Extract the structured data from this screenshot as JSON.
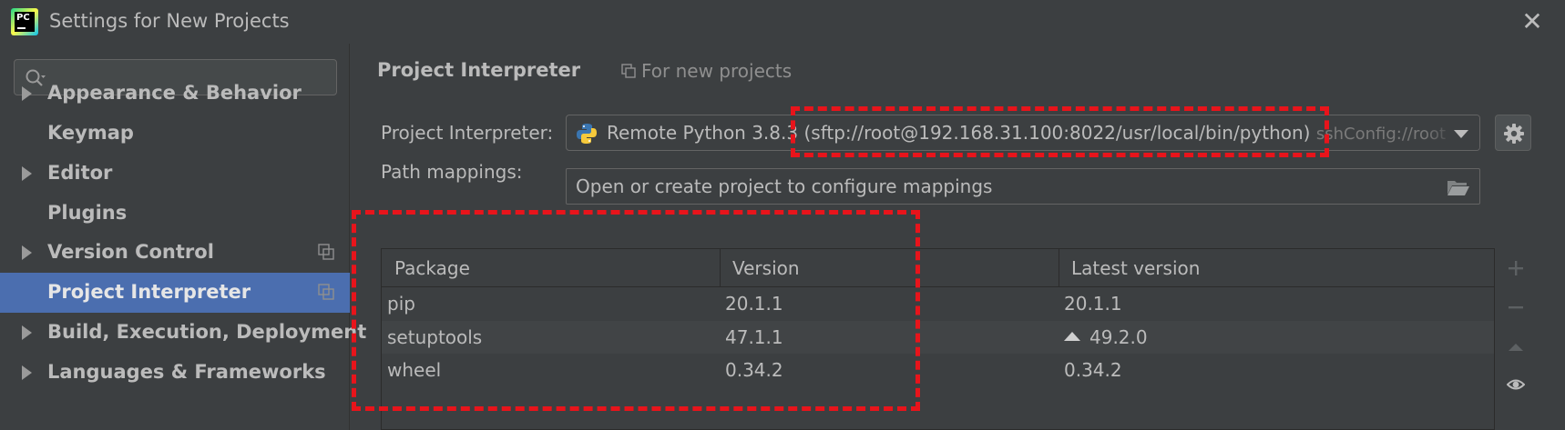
{
  "window": {
    "title": "Settings for New Projects",
    "logo_text": "PC"
  },
  "sidebar": {
    "search": {
      "placeholder": "",
      "value": ""
    },
    "items": [
      {
        "label": "Appearance & Behavior",
        "expandable": true,
        "copy_icon": false,
        "selected": false
      },
      {
        "label": "Keymap",
        "expandable": false,
        "copy_icon": false,
        "selected": false
      },
      {
        "label": "Editor",
        "expandable": true,
        "copy_icon": false,
        "selected": false
      },
      {
        "label": "Plugins",
        "expandable": false,
        "copy_icon": false,
        "selected": false
      },
      {
        "label": "Version Control",
        "expandable": true,
        "copy_icon": true,
        "selected": false
      },
      {
        "label": "Project Interpreter",
        "expandable": false,
        "copy_icon": true,
        "selected": true
      },
      {
        "label": "Build, Execution, Deployment",
        "expandable": true,
        "copy_icon": false,
        "selected": false
      },
      {
        "label": "Languages & Frameworks",
        "expandable": true,
        "copy_icon": false,
        "selected": false
      }
    ]
  },
  "main": {
    "title": "Project Interpreter",
    "scope_hint": "For new projects",
    "interpreter": {
      "label": "Project Interpreter:",
      "prefix": "Remote Python 3.8.3",
      "path": "(sftp://root@192.168.31.100:8022/usr/local/bin/python)",
      "suffix": "sshConfig://root"
    },
    "path_mappings": {
      "label": "Path mappings:",
      "value": "Open or create project to configure mappings"
    },
    "packages": {
      "columns": [
        "Package",
        "Version",
        "Latest version"
      ],
      "rows": [
        {
          "package": "pip",
          "version": "20.1.1",
          "latest": "20.1.1",
          "upgrade": false
        },
        {
          "package": "setuptools",
          "version": "47.1.1",
          "latest": "49.2.0",
          "upgrade": true
        },
        {
          "package": "wheel",
          "version": "0.34.2",
          "latest": "0.34.2",
          "upgrade": false
        }
      ]
    }
  },
  "icons": {
    "search": "search-icon",
    "close": "close-icon",
    "python": "python-icon",
    "gear": "gear-icon",
    "folder": "folder-open-icon",
    "add": "plus-icon",
    "remove": "minus-icon",
    "upgrade": "triangle-up-icon",
    "show": "eye-icon",
    "copy": "copy-icon"
  },
  "colors": {
    "background": "#3c3f41",
    "selection": "#4b6eaf",
    "annotation": "#e8141b",
    "text": "#bbbbbb"
  }
}
